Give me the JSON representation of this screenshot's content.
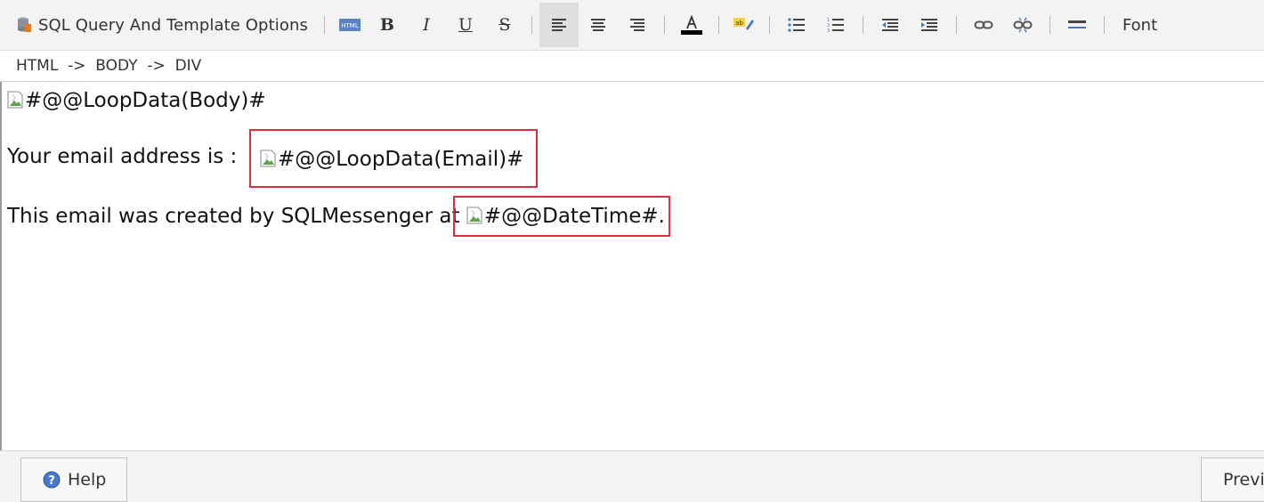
{
  "toolbar": {
    "sql_options_label": "SQL Query And Template Options",
    "bold_label": "B",
    "italic_label": "I",
    "underline_label": "U",
    "strike_label": "S",
    "font_label": "Font"
  },
  "path": {
    "text": "HTML  ->  BODY  ->  DIV"
  },
  "editor": {
    "line1": {
      "text": "#@@LoopData(Body)#"
    },
    "line2": {
      "prefix": "Your email address is : ",
      "field": "#@@LoopData(Email)#"
    },
    "line3": {
      "prefix": "This email was created by SQLMessenger at ",
      "field": "#@@DateTime#",
      "suffix": "."
    }
  },
  "footer": {
    "help_label": "Help",
    "preview_label": "Previ"
  },
  "colors": {
    "highlight": "#e03040",
    "toolbar_bg": "#f3f3f3"
  }
}
